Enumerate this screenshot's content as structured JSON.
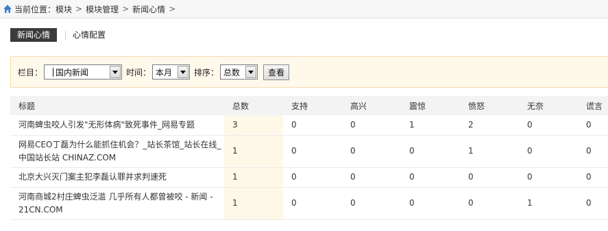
{
  "breadcrumb": {
    "label": "当前位置：",
    "items": [
      "模块",
      "模块管理",
      "新闻心情"
    ],
    "separator": ">"
  },
  "tabs": [
    {
      "label": "新闻心情",
      "active": true
    },
    {
      "label": "心情配置",
      "active": false
    }
  ],
  "filters": {
    "column_label": "栏目：",
    "column_value": "国内新闻",
    "time_label": "时间：",
    "time_value": "本月",
    "sort_label": "排序：",
    "sort_value": "总数",
    "view_button": "查看"
  },
  "table": {
    "headers": [
      "标题",
      "总数",
      "支持",
      "高兴",
      "震惊",
      "愤怒",
      "无奈",
      "谎言"
    ],
    "rows": [
      {
        "title": "河南蜱虫咬人引发\"无形体病\"致死事件_网易专题",
        "values": [
          "3",
          "0",
          "0",
          "1",
          "2",
          "0",
          "0"
        ]
      },
      {
        "title": "网易CEO丁磊为什么能抓住机会？_站长茶馆_站长在线_中国站长站 CHINAZ.COM",
        "values": [
          "1",
          "0",
          "0",
          "0",
          "1",
          "0",
          "0"
        ]
      },
      {
        "title": "北京大兴灭门案主犯李磊认罪并求判速死",
        "values": [
          "1",
          "0",
          "0",
          "0",
          "0",
          "0",
          "0"
        ]
      },
      {
        "title": "河南商城2村庄蜱虫泛滥 几乎所有人都曾被咬 - 新闻 - 21CN.COM",
        "values": [
          "1",
          "0",
          "0",
          "0",
          "0",
          "1",
          "0"
        ]
      }
    ]
  },
  "colors": {
    "active_tab_bg": "#3b3b3b",
    "filter_bg": "#fff9ec",
    "filter_border": "#f4dca8",
    "total_col_bg": "#fdf8e8",
    "home_icon": "#3a7fd0"
  },
  "icons": [
    "home-icon",
    "dropdown-arrow-icon"
  ]
}
